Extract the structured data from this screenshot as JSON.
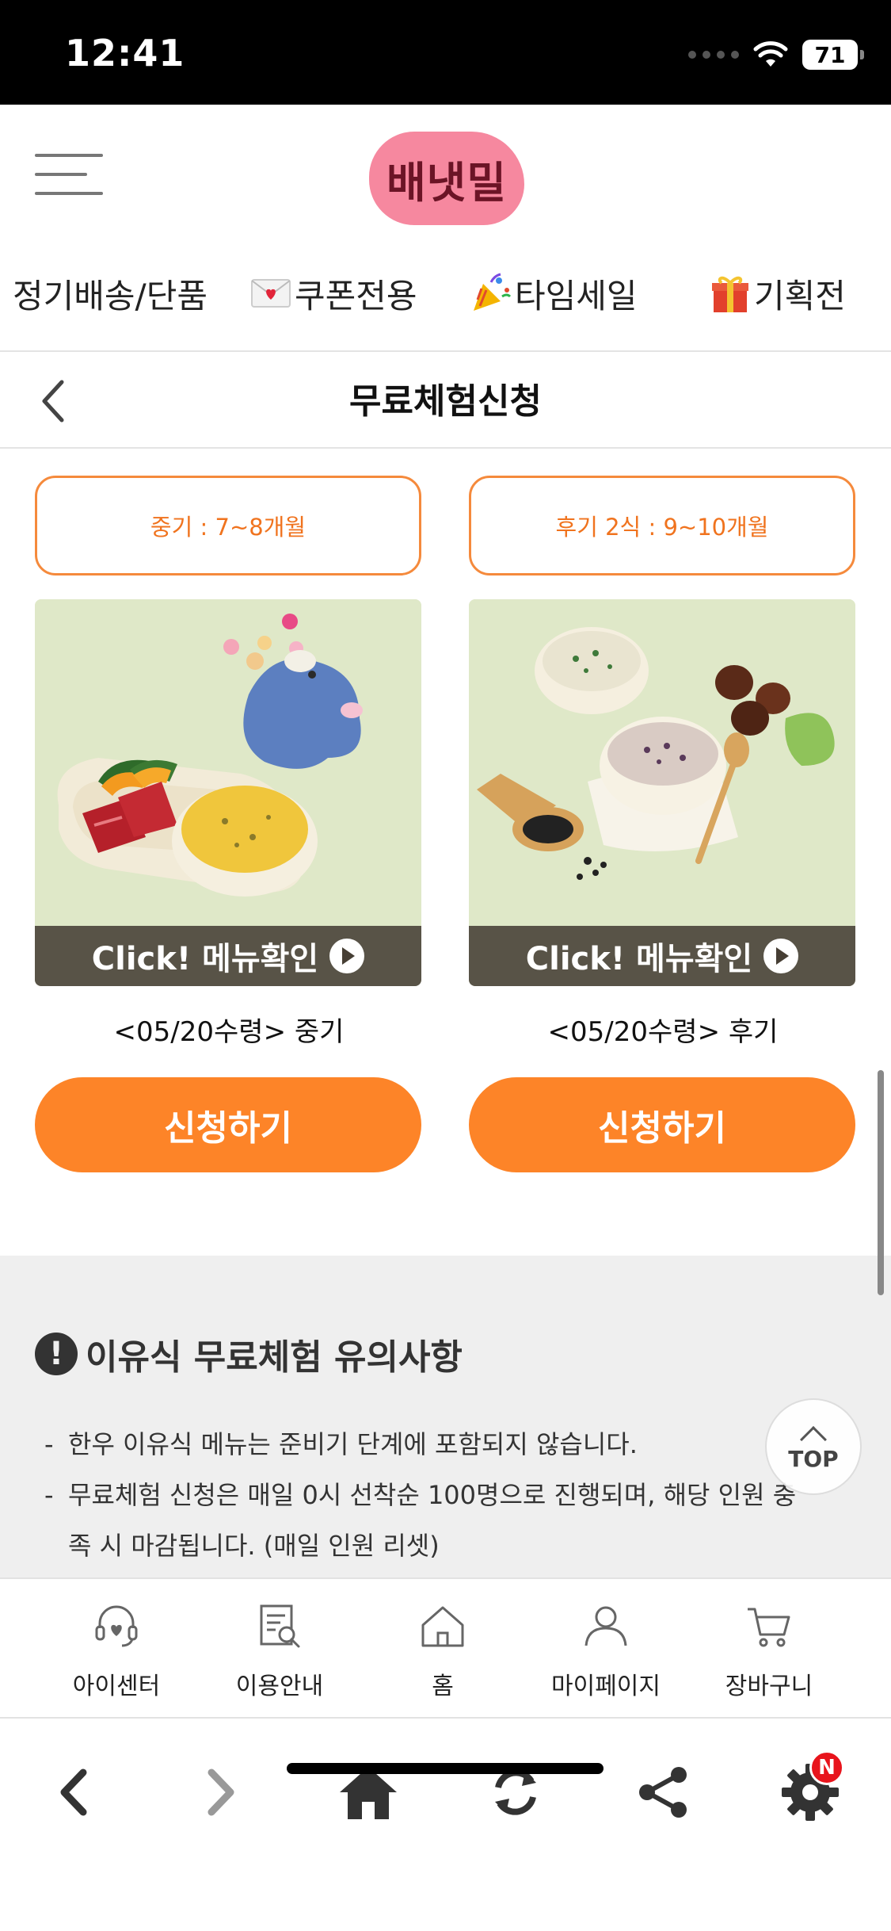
{
  "status_bar": {
    "time": "12:41",
    "battery": "71"
  },
  "header": {
    "logo_text": "배냇밀"
  },
  "category_nav": [
    {
      "label": "정기배송/단품",
      "icon": ""
    },
    {
      "label": "쿠폰전용",
      "icon": "love-letter-icon"
    },
    {
      "label": "타임세일",
      "icon": "party-popper-icon"
    },
    {
      "label": "기획전",
      "icon": "gift-icon"
    }
  ],
  "title_bar": {
    "title": "무료체험신청"
  },
  "products": [
    {
      "stage": "중기 : 7~8개월",
      "banner": "Click! 메뉴확인",
      "name": "<05/20수령> 중기",
      "button": "신청하기"
    },
    {
      "stage": "후기 2식 : 9~10개월",
      "banner": "Click! 메뉴확인",
      "name": "<05/20수령> 후기",
      "button": "신청하기"
    }
  ],
  "notice": {
    "title": "이유식 무료체험 유의사항",
    "items": [
      "한우 이유식 메뉴는 준비기 단계에 포함되지 않습니다.",
      "무료체험 신청은 매일 0시 선착순 100명으로 진행되며, 해당 인원 충족 시 마감됩니다. (매일 인원 리셋)"
    ]
  },
  "top_button": "TOP",
  "site_nav": [
    {
      "label": "아이센터",
      "icon": "headset-heart-icon"
    },
    {
      "label": "이용안내",
      "icon": "document-search-icon"
    },
    {
      "label": "홈",
      "icon": "home-outline-icon"
    },
    {
      "label": "마이페이지",
      "icon": "person-icon"
    },
    {
      "label": "장바구니",
      "icon": "cart-icon"
    }
  ],
  "browser_bar": {
    "settings_badge": "N"
  },
  "colors": {
    "accent": "#fd8428",
    "logo_bg": "#f6889f",
    "logo_text": "#6b1426",
    "notice_bg": "#efefef"
  }
}
